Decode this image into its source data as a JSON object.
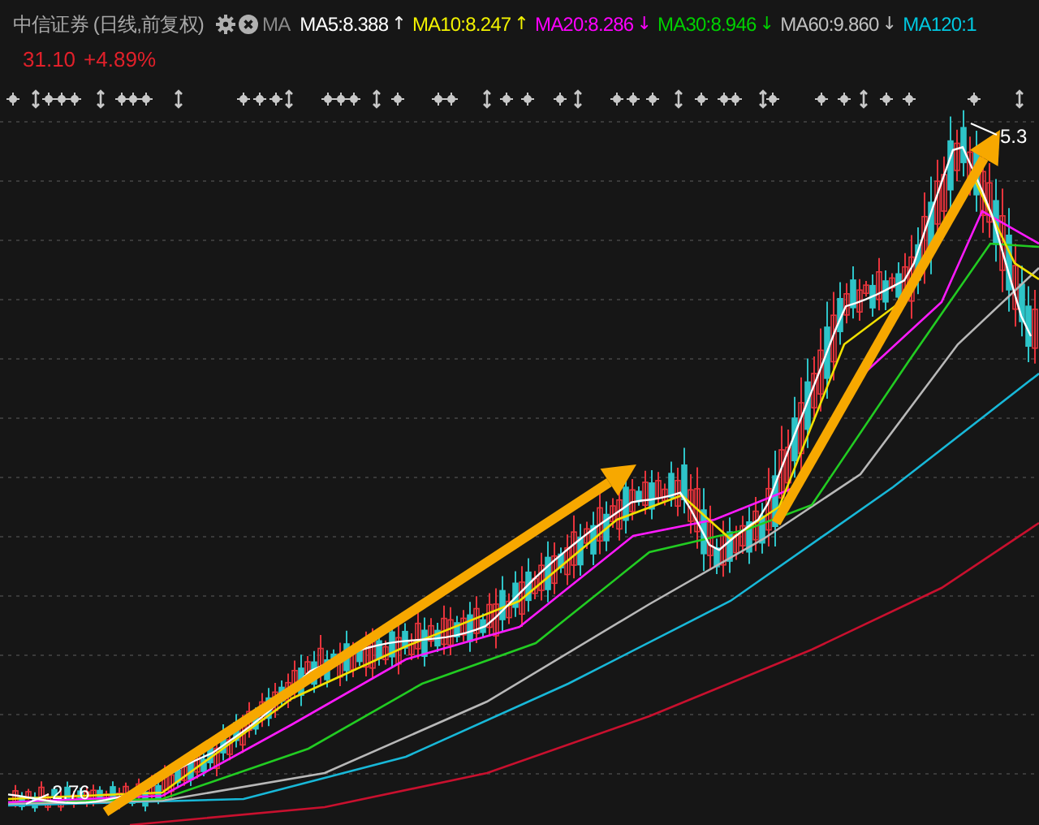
{
  "header": {
    "title": "中信证券 (日线,前复权)",
    "ma_label": "MA",
    "indicators": [
      {
        "label": "MA5:8.388",
        "trend": "↑",
        "color": "#ffffff"
      },
      {
        "label": "MA10:8.247",
        "trend": "↑",
        "color": "#f2f200"
      },
      {
        "label": "MA20:8.286",
        "trend": "↓",
        "color": "#ff00ff"
      },
      {
        "label": "MA30:8.946",
        "trend": "↓",
        "color": "#00d000"
      },
      {
        "label": "MA60:9.860",
        "trend": "↓",
        "color": "#c0c0c0"
      },
      {
        "label": "MA120:1",
        "color": "#00c8e0"
      }
    ]
  },
  "quote": {
    "price": "31.10",
    "change": "+4.89%"
  },
  "chart": {
    "low_label": "2.76",
    "high_label": "5.3"
  }
}
